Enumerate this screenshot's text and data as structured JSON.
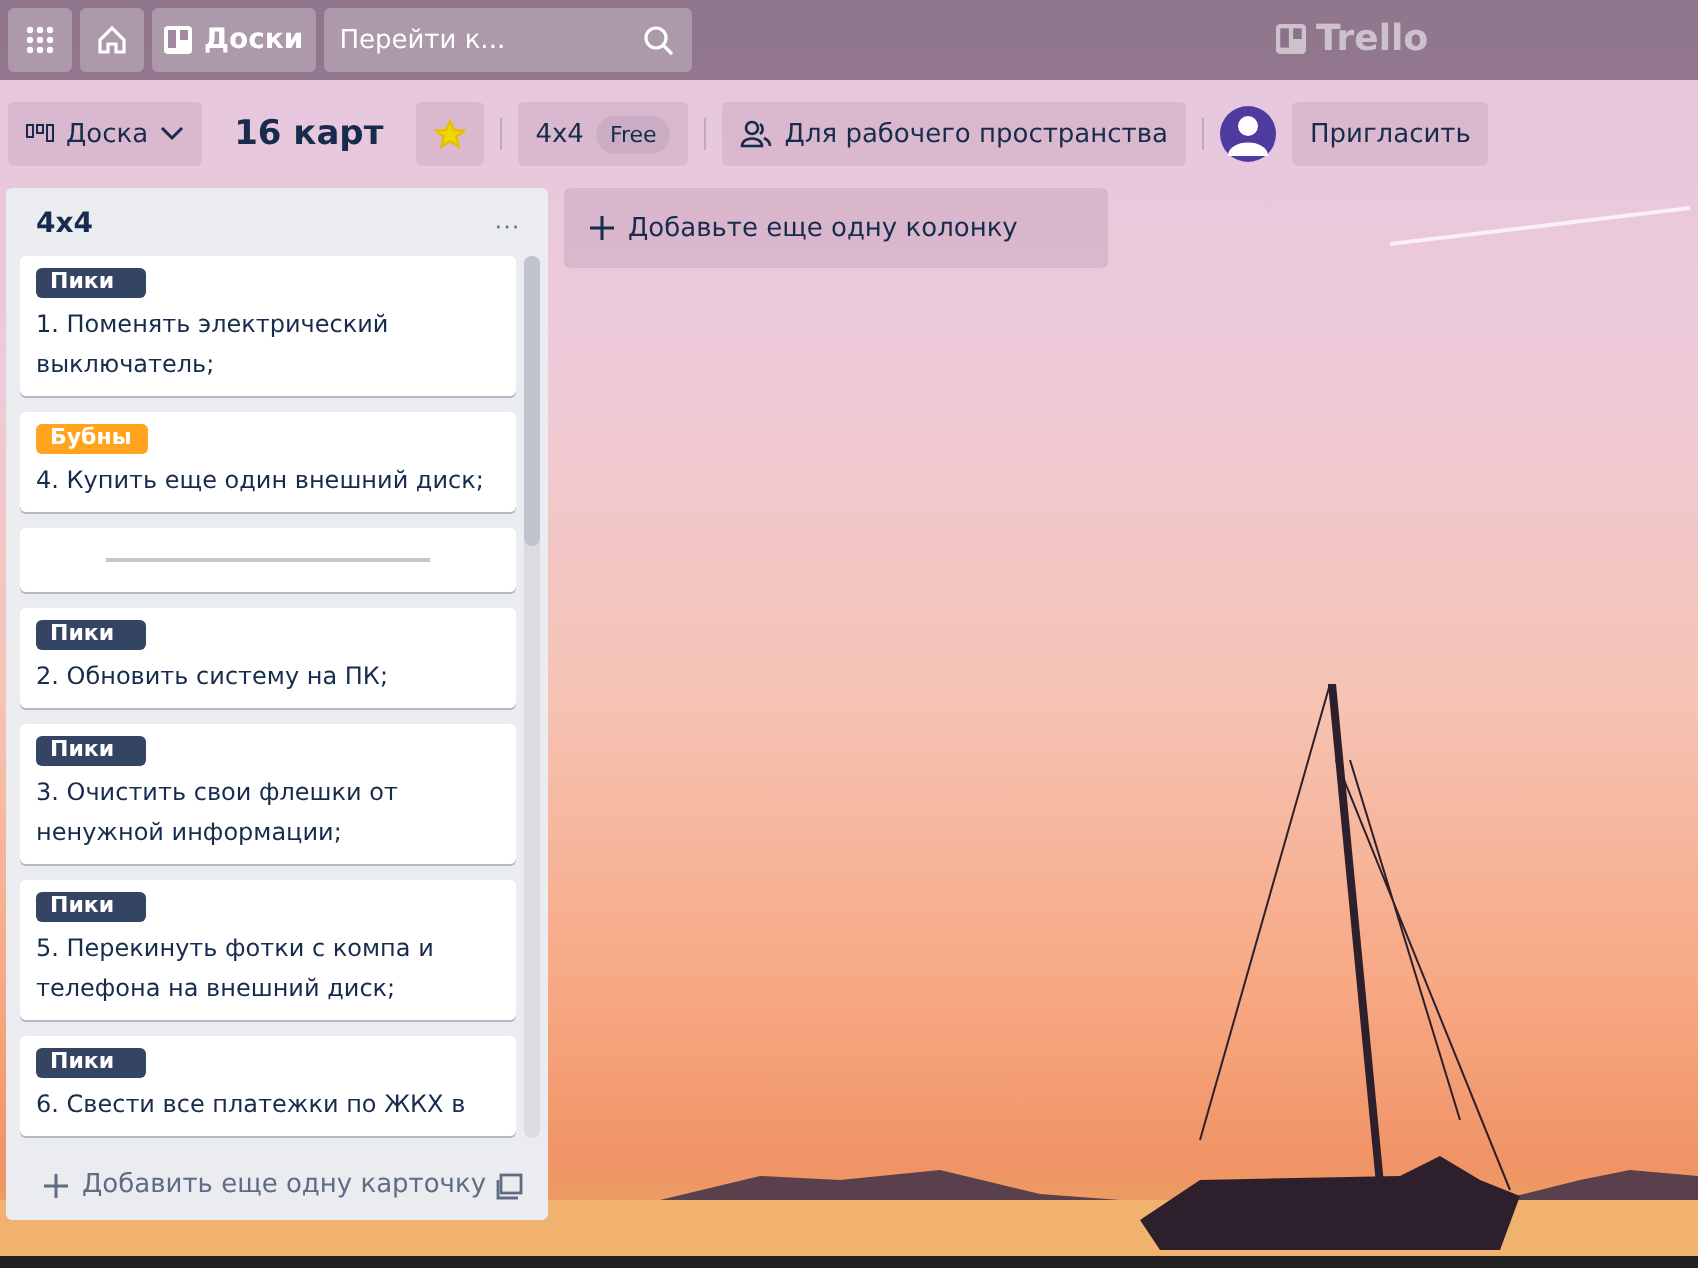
{
  "top_bar": {
    "boards_label": "Доски",
    "search": {
      "placeholder": "Перейти к..."
    },
    "logo_text": "Trello"
  },
  "board_header": {
    "view": "Доска",
    "title": "16 карт",
    "starred": true,
    "workspace": "4x4",
    "plan": "Free",
    "visibility": "Для рабочего пространства",
    "invite": "Пригласить"
  },
  "list": {
    "title": "4x4",
    "menu": "···",
    "cards": [
      {
        "kind": "task",
        "label": {
          "text": "Пики",
          "color": "#344563"
        },
        "text": "1. Поменять электрический выключатель;"
      },
      {
        "kind": "task",
        "label": {
          "text": "Бубны",
          "color": "#ffa41c"
        },
        "text": "4. Купить еще один внешний диск;"
      },
      {
        "kind": "divider"
      },
      {
        "kind": "task",
        "label": {
          "text": "Пики",
          "color": "#344563"
        },
        "text": "2. Обновить систему на ПК;"
      },
      {
        "kind": "task",
        "label": {
          "text": "Пики",
          "color": "#344563"
        },
        "text": "3. Очистить свои флешки от ненужной информации;"
      },
      {
        "kind": "task",
        "label": {
          "text": "Пики",
          "color": "#344563"
        },
        "text": "5. Перекинуть фотки с компа и телефона на внешний диск;"
      },
      {
        "kind": "task",
        "label": {
          "text": "Пики",
          "color": "#344563"
        },
        "text": "6. Свести все платежки по ЖКХ в"
      }
    ],
    "add_card": "Добавить еще одну карточку"
  },
  "add_list": "Добавьте еще одну колонку"
}
